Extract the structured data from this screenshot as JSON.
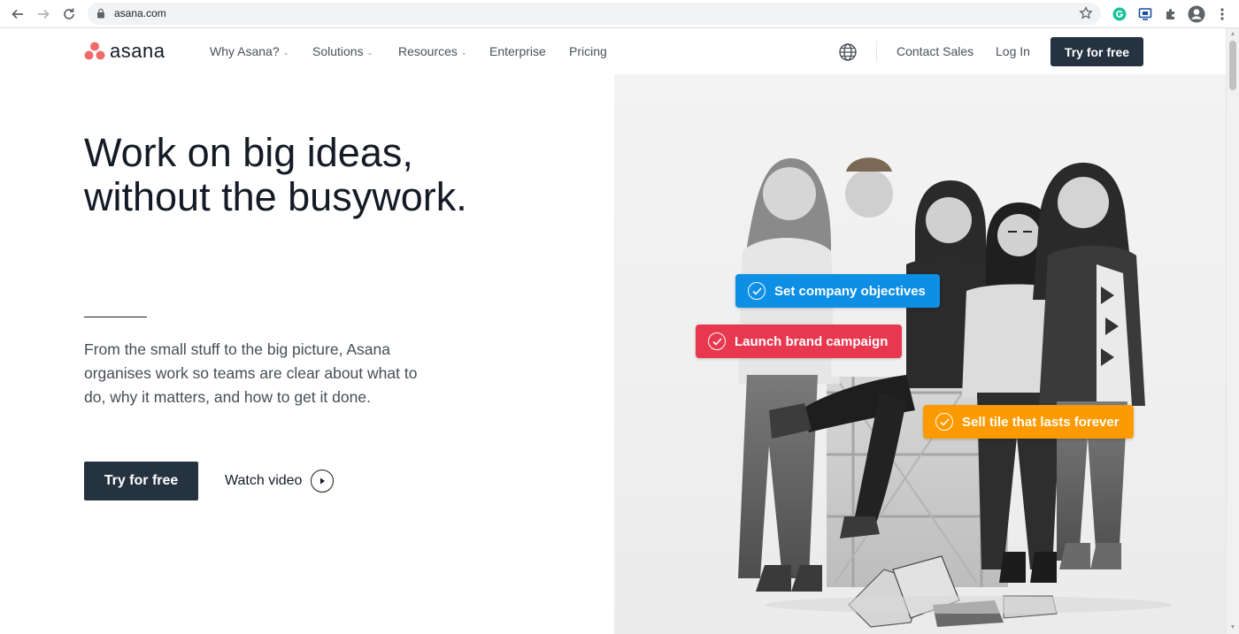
{
  "browser": {
    "url": "asana.com",
    "icons": {
      "back": "arrow-left-icon",
      "forward": "arrow-right-icon",
      "reload": "reload-icon",
      "lock": "lock-icon",
      "bookmark": "star-icon",
      "extensions": [
        "grammarly-icon",
        "screen-icon",
        "puzzle-icon",
        "profile-icon",
        "more-vertical-icon"
      ]
    }
  },
  "header": {
    "logo_text": "asana",
    "nav": [
      {
        "label": "Why Asana?",
        "has_dropdown": true
      },
      {
        "label": "Solutions",
        "has_dropdown": true
      },
      {
        "label": "Resources",
        "has_dropdown": true
      },
      {
        "label": "Enterprise",
        "has_dropdown": false
      },
      {
        "label": "Pricing",
        "has_dropdown": false
      }
    ],
    "contact_sales": "Contact Sales",
    "login": "Log In",
    "cta": "Try for free"
  },
  "hero": {
    "title_line1": "Work on big ideas,",
    "title_line2": "without the busywork.",
    "description": "From the small stuff to the big picture, Asana organises work so teams are clear about what to do, why it matters, and how to get it done.",
    "cta": "Try for free",
    "watch_video": "Watch video"
  },
  "task_tags": [
    {
      "label": "Set company objectives",
      "color": "#0d8fe6"
    },
    {
      "label": "Launch brand campaign",
      "color": "#e8384f"
    },
    {
      "label": "Sell tile that lasts forever",
      "color": "#fd9a00"
    }
  ],
  "colors": {
    "brand_dark": "#253240",
    "logo_coral": "#f06a6a"
  }
}
